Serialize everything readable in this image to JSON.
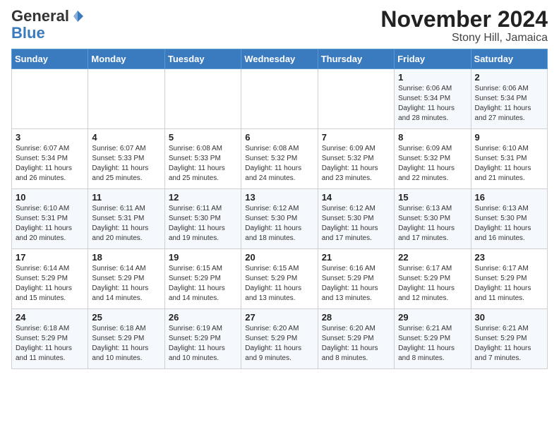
{
  "header": {
    "logo_general": "General",
    "logo_blue": "Blue",
    "month_title": "November 2024",
    "location": "Stony Hill, Jamaica"
  },
  "weekdays": [
    "Sunday",
    "Monday",
    "Tuesday",
    "Wednesday",
    "Thursday",
    "Friday",
    "Saturday"
  ],
  "weeks": [
    [
      {
        "day": "",
        "info": ""
      },
      {
        "day": "",
        "info": ""
      },
      {
        "day": "",
        "info": ""
      },
      {
        "day": "",
        "info": ""
      },
      {
        "day": "",
        "info": ""
      },
      {
        "day": "1",
        "info": "Sunrise: 6:06 AM\nSunset: 5:34 PM\nDaylight: 11 hours\nand 28 minutes."
      },
      {
        "day": "2",
        "info": "Sunrise: 6:06 AM\nSunset: 5:34 PM\nDaylight: 11 hours\nand 27 minutes."
      }
    ],
    [
      {
        "day": "3",
        "info": "Sunrise: 6:07 AM\nSunset: 5:34 PM\nDaylight: 11 hours\nand 26 minutes."
      },
      {
        "day": "4",
        "info": "Sunrise: 6:07 AM\nSunset: 5:33 PM\nDaylight: 11 hours\nand 25 minutes."
      },
      {
        "day": "5",
        "info": "Sunrise: 6:08 AM\nSunset: 5:33 PM\nDaylight: 11 hours\nand 25 minutes."
      },
      {
        "day": "6",
        "info": "Sunrise: 6:08 AM\nSunset: 5:32 PM\nDaylight: 11 hours\nand 24 minutes."
      },
      {
        "day": "7",
        "info": "Sunrise: 6:09 AM\nSunset: 5:32 PM\nDaylight: 11 hours\nand 23 minutes."
      },
      {
        "day": "8",
        "info": "Sunrise: 6:09 AM\nSunset: 5:32 PM\nDaylight: 11 hours\nand 22 minutes."
      },
      {
        "day": "9",
        "info": "Sunrise: 6:10 AM\nSunset: 5:31 PM\nDaylight: 11 hours\nand 21 minutes."
      }
    ],
    [
      {
        "day": "10",
        "info": "Sunrise: 6:10 AM\nSunset: 5:31 PM\nDaylight: 11 hours\nand 20 minutes."
      },
      {
        "day": "11",
        "info": "Sunrise: 6:11 AM\nSunset: 5:31 PM\nDaylight: 11 hours\nand 20 minutes."
      },
      {
        "day": "12",
        "info": "Sunrise: 6:11 AM\nSunset: 5:30 PM\nDaylight: 11 hours\nand 19 minutes."
      },
      {
        "day": "13",
        "info": "Sunrise: 6:12 AM\nSunset: 5:30 PM\nDaylight: 11 hours\nand 18 minutes."
      },
      {
        "day": "14",
        "info": "Sunrise: 6:12 AM\nSunset: 5:30 PM\nDaylight: 11 hours\nand 17 minutes."
      },
      {
        "day": "15",
        "info": "Sunrise: 6:13 AM\nSunset: 5:30 PM\nDaylight: 11 hours\nand 17 minutes."
      },
      {
        "day": "16",
        "info": "Sunrise: 6:13 AM\nSunset: 5:30 PM\nDaylight: 11 hours\nand 16 minutes."
      }
    ],
    [
      {
        "day": "17",
        "info": "Sunrise: 6:14 AM\nSunset: 5:29 PM\nDaylight: 11 hours\nand 15 minutes."
      },
      {
        "day": "18",
        "info": "Sunrise: 6:14 AM\nSunset: 5:29 PM\nDaylight: 11 hours\nand 14 minutes."
      },
      {
        "day": "19",
        "info": "Sunrise: 6:15 AM\nSunset: 5:29 PM\nDaylight: 11 hours\nand 14 minutes."
      },
      {
        "day": "20",
        "info": "Sunrise: 6:15 AM\nSunset: 5:29 PM\nDaylight: 11 hours\nand 13 minutes."
      },
      {
        "day": "21",
        "info": "Sunrise: 6:16 AM\nSunset: 5:29 PM\nDaylight: 11 hours\nand 13 minutes."
      },
      {
        "day": "22",
        "info": "Sunrise: 6:17 AM\nSunset: 5:29 PM\nDaylight: 11 hours\nand 12 minutes."
      },
      {
        "day": "23",
        "info": "Sunrise: 6:17 AM\nSunset: 5:29 PM\nDaylight: 11 hours\nand 11 minutes."
      }
    ],
    [
      {
        "day": "24",
        "info": "Sunrise: 6:18 AM\nSunset: 5:29 PM\nDaylight: 11 hours\nand 11 minutes."
      },
      {
        "day": "25",
        "info": "Sunrise: 6:18 AM\nSunset: 5:29 PM\nDaylight: 11 hours\nand 10 minutes."
      },
      {
        "day": "26",
        "info": "Sunrise: 6:19 AM\nSunset: 5:29 PM\nDaylight: 11 hours\nand 10 minutes."
      },
      {
        "day": "27",
        "info": "Sunrise: 6:20 AM\nSunset: 5:29 PM\nDaylight: 11 hours\nand 9 minutes."
      },
      {
        "day": "28",
        "info": "Sunrise: 6:20 AM\nSunset: 5:29 PM\nDaylight: 11 hours\nand 8 minutes."
      },
      {
        "day": "29",
        "info": "Sunrise: 6:21 AM\nSunset: 5:29 PM\nDaylight: 11 hours\nand 8 minutes."
      },
      {
        "day": "30",
        "info": "Sunrise: 6:21 AM\nSunset: 5:29 PM\nDaylight: 11 hours\nand 7 minutes."
      }
    ]
  ]
}
